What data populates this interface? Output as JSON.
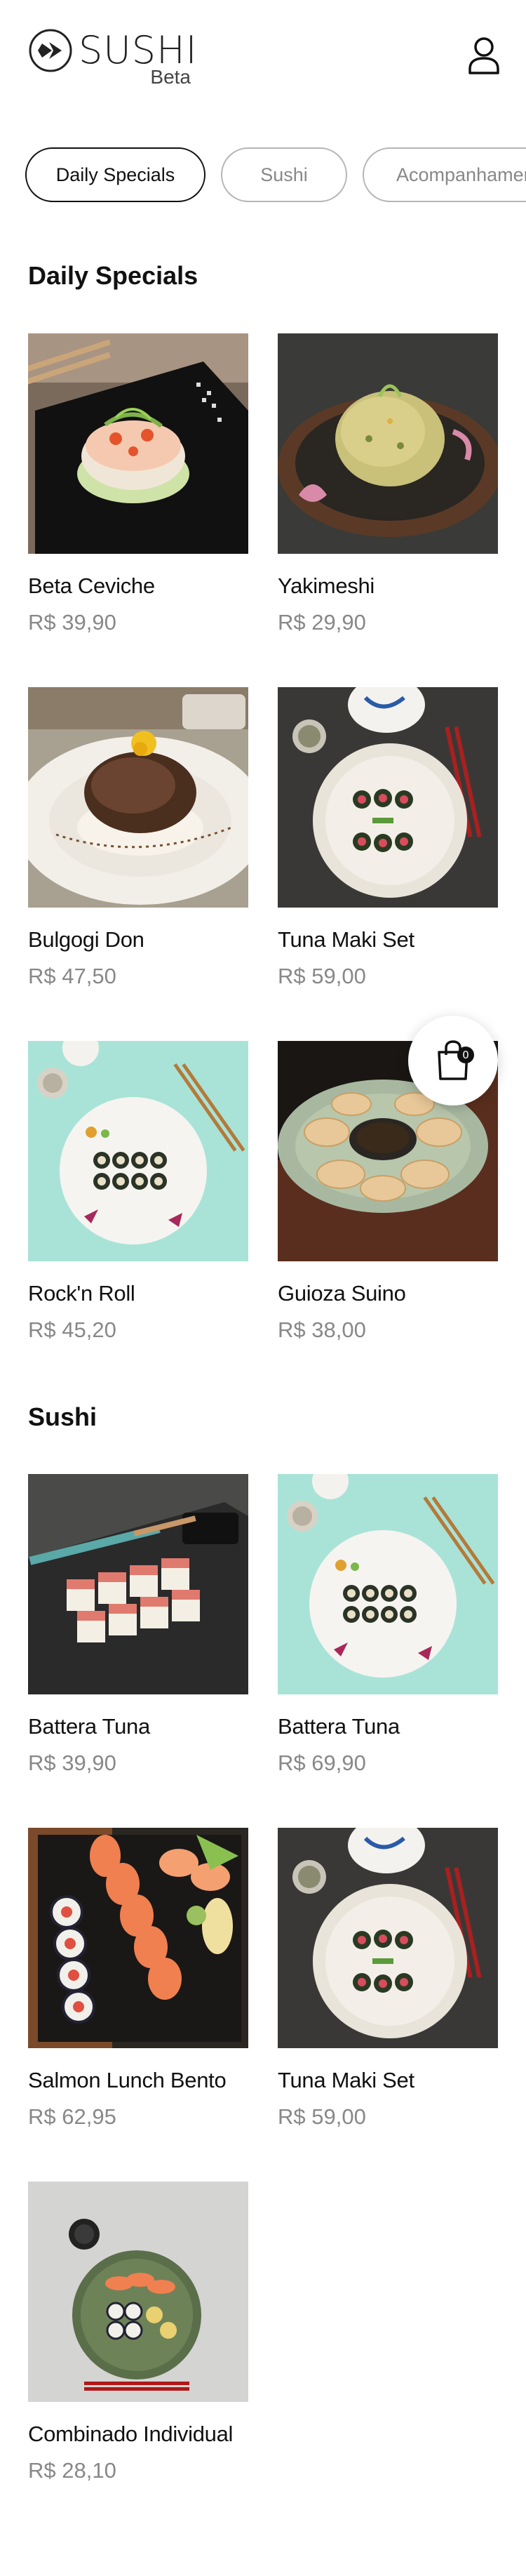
{
  "brand": {
    "name": "SUSHI",
    "tag": "Beta"
  },
  "tabs": [
    {
      "label": "Daily Specials"
    },
    {
      "label": "Sushi"
    },
    {
      "label": "Acompanhamentos"
    }
  ],
  "sections": [
    {
      "title": "Daily Specials",
      "items": [
        {
          "name": "Beta Ceviche",
          "price": "R$ 39,90",
          "photo": "ceviche-dish"
        },
        {
          "name": "Yakimeshi",
          "price": "R$ 29,90",
          "photo": "fried-rice-dish"
        },
        {
          "name": "Bulgogi Don",
          "price": "R$ 47,50",
          "photo": "bulgogi-rice-bowl"
        },
        {
          "name": "Tuna Maki Set",
          "price": "R$ 59,00",
          "photo": "maki-plate-dark"
        },
        {
          "name": "Rock'n Roll",
          "price": "R$ 45,20",
          "photo": "maki-plate-mint"
        },
        {
          "name": "Guioza Suino",
          "price": "R$ 38,00",
          "photo": "gyoza-plate"
        }
      ]
    },
    {
      "title": "Sushi",
      "items": [
        {
          "name": "Battera Tuna",
          "price": "R$ 39,90",
          "photo": "battera-board"
        },
        {
          "name": "Battera Tuna",
          "price": "R$ 69,90",
          "photo": "maki-plate-mint"
        },
        {
          "name": "Salmon Lunch Bento",
          "price": "R$ 62,95",
          "photo": "salmon-bento"
        },
        {
          "name": "Tuna Maki Set",
          "price": "R$ 59,00",
          "photo": "maki-plate-dark"
        },
        {
          "name": "Combinado Individual",
          "price": "R$ 28,10",
          "photo": "combo-plate"
        }
      ]
    }
  ],
  "cart": {
    "count": "0",
    "icon": "shopping-bag-icon"
  },
  "icons": {
    "logo": "sushi-logo-icon",
    "profile": "user-icon"
  },
  "colors": {
    "text": "#111111",
    "muted": "#888888",
    "border": "#b5b5b5",
    "background": "#ffffff"
  }
}
